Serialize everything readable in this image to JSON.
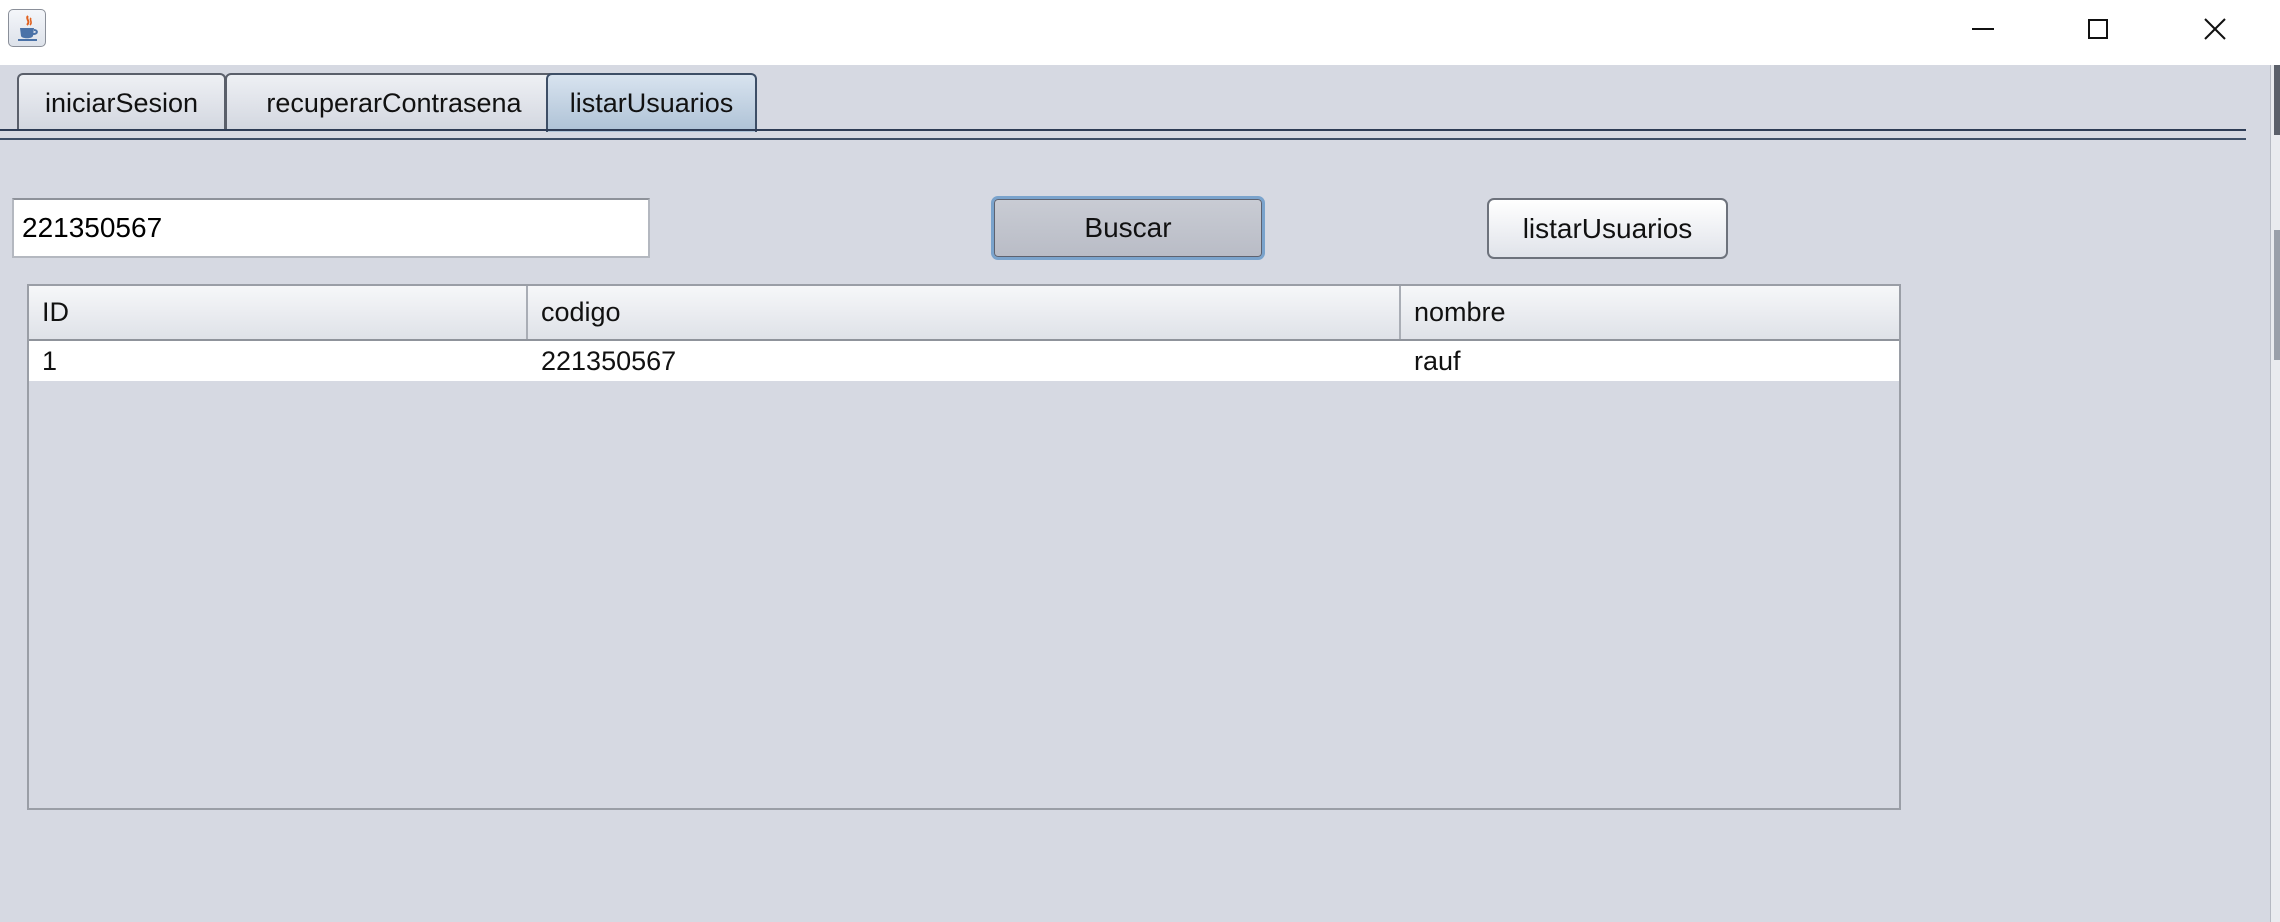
{
  "window": {
    "icon": "java-cup-icon",
    "controls": [
      "minimize-icon",
      "maximize-icon",
      "close-icon"
    ]
  },
  "tabs": [
    {
      "label": "iniciarSesion",
      "active": false
    },
    {
      "label": "recuperarContrasena",
      "active": false
    },
    {
      "label": "listarUsuarios",
      "active": true
    }
  ],
  "search": {
    "value": "221350567"
  },
  "buttons": {
    "search_label": "Buscar",
    "list_label": "listarUsuarios"
  },
  "table": {
    "columns": [
      "ID",
      "codigo",
      "nombre"
    ],
    "rows": [
      [
        "1",
        "221350567",
        "rauf"
      ]
    ]
  },
  "colors": {
    "background": "#d6d9e2",
    "active_tab": "#aec2d6",
    "focus_border": "#7aa3cc"
  }
}
